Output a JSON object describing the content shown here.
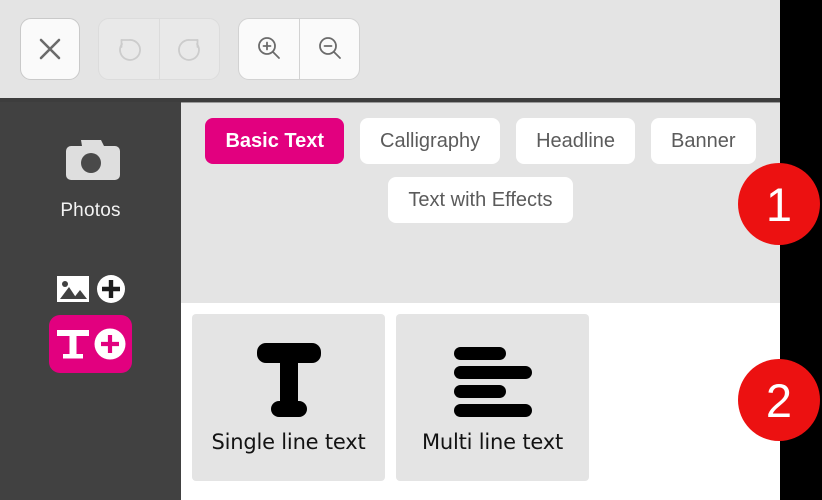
{
  "toolbar": {
    "close_label": "×",
    "close_icon": "close-icon",
    "undo_icon": "undo-icon",
    "redo_icon": "redo-icon",
    "zoom_in_icon": "zoom-in-icon",
    "zoom_out_icon": "zoom-out-icon"
  },
  "sidebar": {
    "photos_label": "Photos",
    "photos_icon": "camera-icon",
    "add_image_icon": "image-plus-icon",
    "add_text_icon": "text-plus-icon",
    "background_color": "#414141",
    "accent_color": "#e2007f"
  },
  "categories": {
    "row1": [
      {
        "label": "Basic Text",
        "selected": true
      },
      {
        "label": "Calligraphy",
        "selected": false
      },
      {
        "label": "Headline",
        "selected": false
      },
      {
        "label": "Banner",
        "selected": false
      }
    ],
    "row2": [
      {
        "label": "Text with Effects",
        "selected": false
      }
    ]
  },
  "cards": [
    {
      "label": "Single line text",
      "icon": "single-line-text-icon"
    },
    {
      "label": "Multi line text",
      "icon": "multi-line-text-icon"
    }
  ],
  "badges": [
    {
      "label": "1",
      "color": "#ec1111"
    },
    {
      "label": "2",
      "color": "#ec1111"
    }
  ]
}
